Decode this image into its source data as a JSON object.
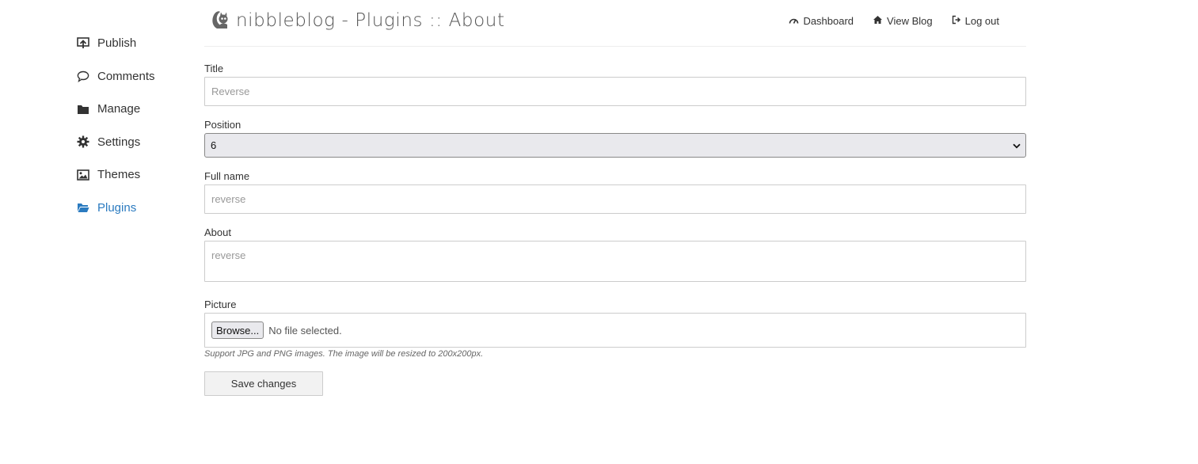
{
  "sidebar": {
    "items": [
      {
        "label": "Publish",
        "icon": "publish-icon"
      },
      {
        "label": "Comments",
        "icon": "comment-icon"
      },
      {
        "label": "Manage",
        "icon": "folder-icon"
      },
      {
        "label": "Settings",
        "icon": "gear-icon"
      },
      {
        "label": "Themes",
        "icon": "image-icon"
      },
      {
        "label": "Plugins",
        "icon": "folder-open-icon",
        "active": true
      }
    ]
  },
  "header": {
    "title": "nibbleblog - Plugins :: About",
    "nav": [
      {
        "label": "Dashboard",
        "icon": "dashboard-icon"
      },
      {
        "label": "View Blog",
        "icon": "home-icon"
      },
      {
        "label": "Log out",
        "icon": "logout-icon"
      }
    ]
  },
  "form": {
    "title": {
      "label": "Title",
      "placeholder": "Reverse"
    },
    "position": {
      "label": "Position",
      "value": "6"
    },
    "full_name": {
      "label": "Full name",
      "placeholder": "reverse"
    },
    "about": {
      "label": "About",
      "placeholder": "reverse"
    },
    "picture": {
      "label": "Picture",
      "browse_label": "Browse...",
      "no_file_text": "No file selected.",
      "hint": "Support JPG and PNG images. The image will be resized to 200x200px."
    },
    "save_label": "Save changes"
  },
  "colors": {
    "accent": "#2b7bc0",
    "text": "#333333",
    "border": "#cccccc"
  }
}
